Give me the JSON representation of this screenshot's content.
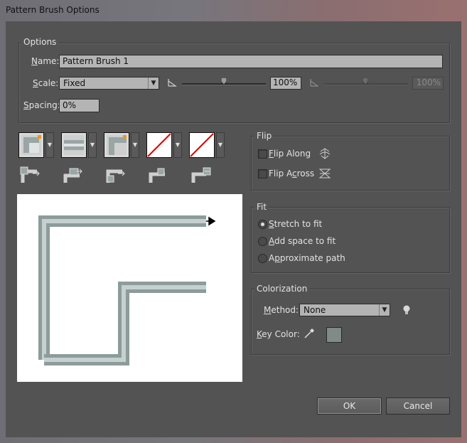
{
  "window": {
    "title": "Pattern Brush Options"
  },
  "options": {
    "legend": "Options",
    "name_label": "Name:",
    "name_value": "Pattern Brush 1",
    "scale_label": "Scale:",
    "scale_value": "Fixed",
    "scale_percent": "100%",
    "scale_percent_2": "100%",
    "spacing_label": "Spacing:",
    "spacing_value": "0%"
  },
  "tiles": [
    {
      "name": "side-tile",
      "icon": "tile-side-icon"
    },
    {
      "name": "outer-corner-tile",
      "icon": "tile-outer-corner-icon"
    },
    {
      "name": "inner-corner-tile",
      "icon": "tile-inner-corner-icon"
    },
    {
      "name": "start-tile",
      "icon": "tile-none-icon"
    },
    {
      "name": "end-tile",
      "icon": "tile-none-icon"
    }
  ],
  "flip": {
    "legend": "Flip",
    "along_label": "Flip Along",
    "along_checked": false,
    "across_label": "Flip Across",
    "across_checked": false
  },
  "fit": {
    "legend": "Fit",
    "options": [
      "Stretch to fit",
      "Add space to fit",
      "Approximate path"
    ],
    "selected": "Stretch to fit"
  },
  "colorization": {
    "legend": "Colorization",
    "method_label": "Method:",
    "method_value": "None",
    "key_color_label": "Key Color:",
    "key_color": "#7f8a89"
  },
  "buttons": {
    "ok": "OK",
    "cancel": "Cancel"
  },
  "colors": {
    "dialog_bg": "#535353",
    "field_bg": "#b4b4b4",
    "pattern": "#9fb0ae",
    "no_tile_slash": "#e00000"
  }
}
